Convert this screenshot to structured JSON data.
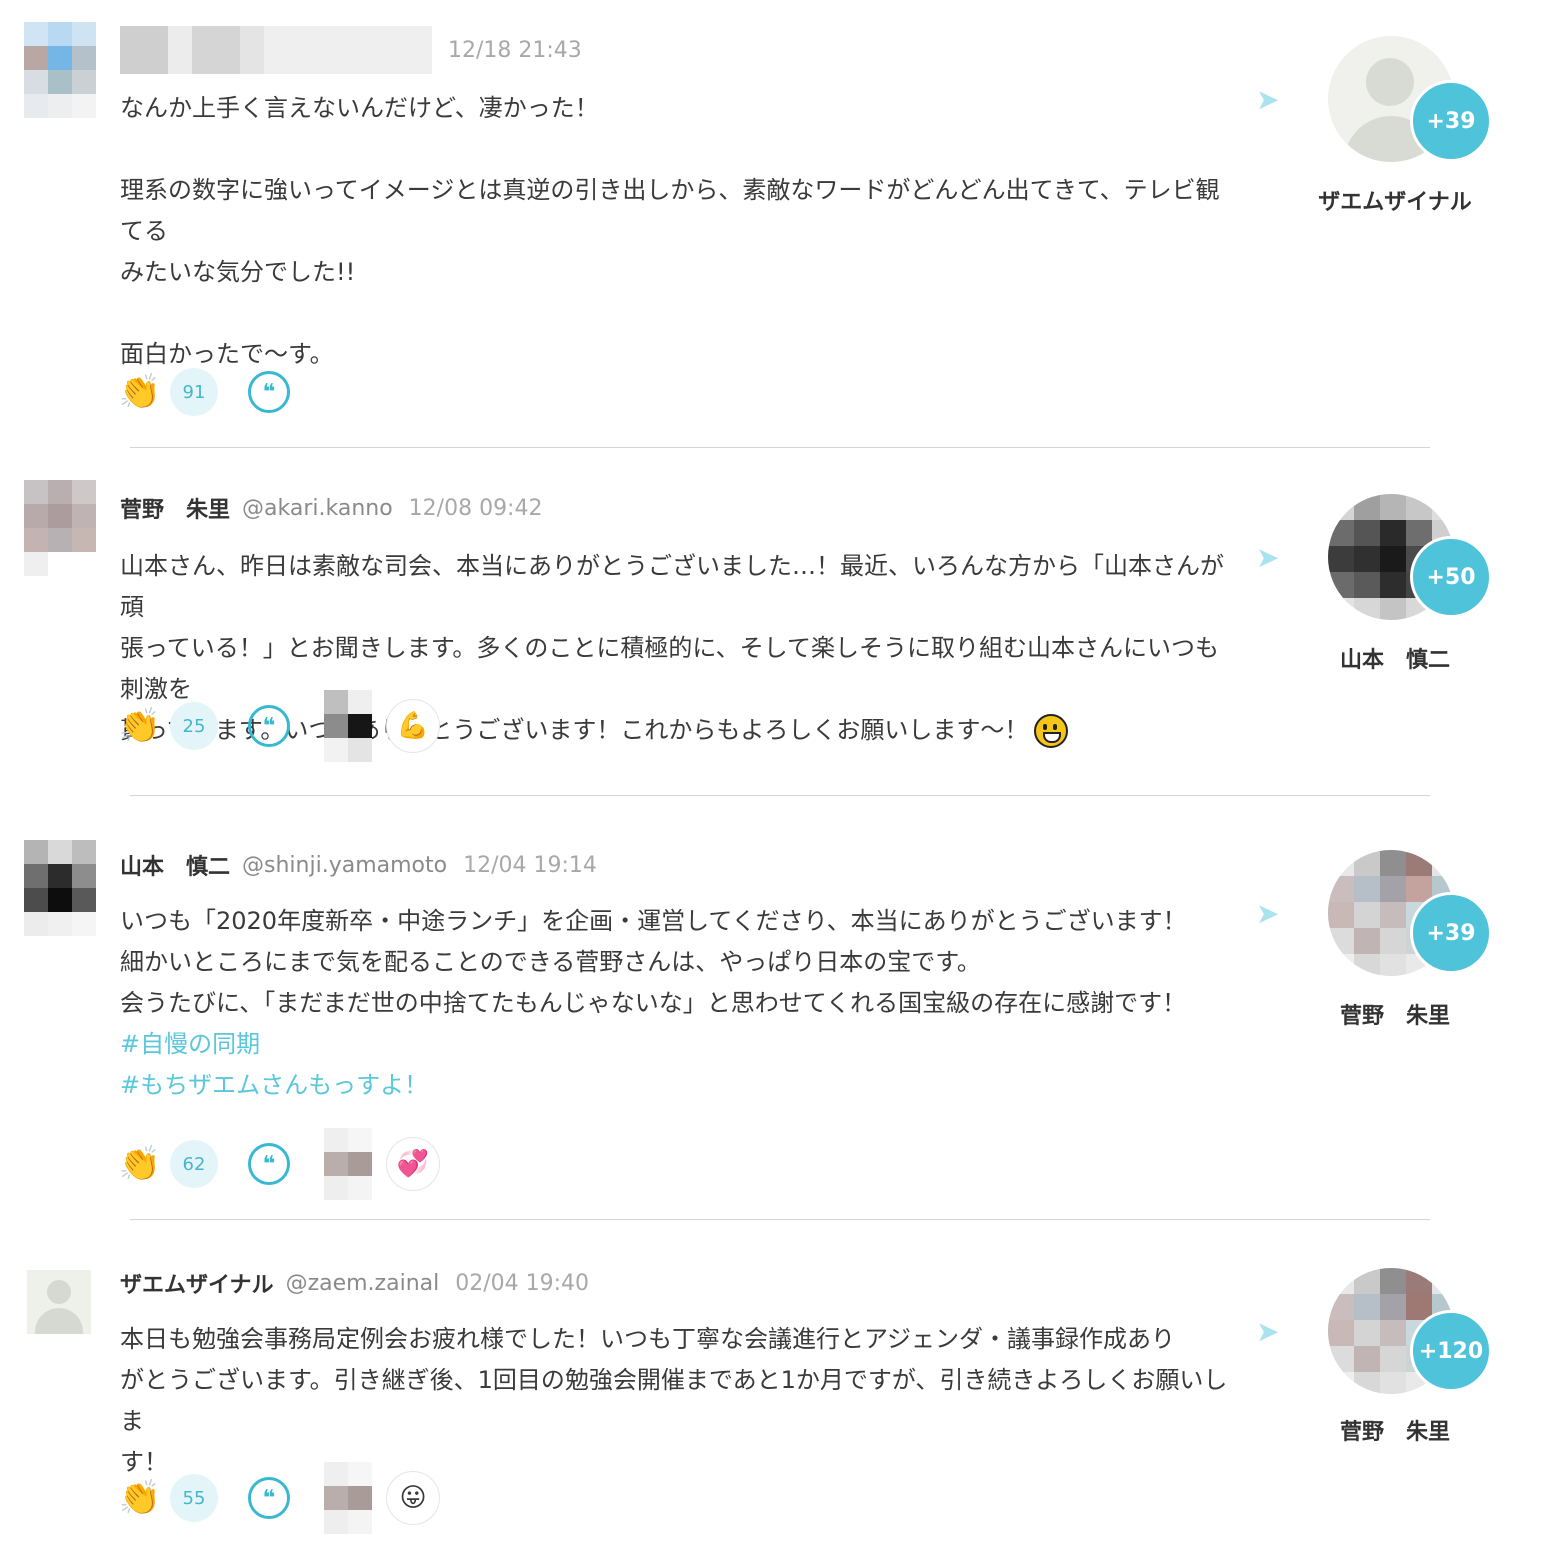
{
  "posts": [
    {
      "name": "",
      "handle": "",
      "time": "12/18 21:43",
      "lines": [
        "なんか上手く言えないんだけど、凄かった！",
        "",
        "理系の数字に強いってイメージとは真逆の引き出しから、素敵なワードがどんどん出てきて、テレビ観てる",
        "みたいな気分でした!!",
        "",
        "面白かったで～す。"
      ],
      "hashtags": [],
      "clap_count": "91",
      "reaction_emoji": "",
      "recipient_name": "ザエムザイナル",
      "recipient_bonus": "+39"
    },
    {
      "name": "菅野　朱里",
      "handle": "@akari.kanno",
      "time": "12/08 09:42",
      "lines": [
        "山本さん、昨日は素敵な司会、本当にありがとうございました…！最近、いろんな方から「山本さんが頑",
        "張っている！」とお聞きします。多くのことに積極的に、そして楽しそうに取り組む山本さんにいつも刺激を",
        "貰っています。いつもありがとうございます！これからもよろしくお願いします～！"
      ],
      "hashtags": [],
      "clap_count": "25",
      "reaction_emoji": "💪",
      "recipient_name": "山本　慎二",
      "recipient_bonus": "+50"
    },
    {
      "name": "山本　慎二",
      "handle": "@shinji.yamamoto",
      "time": "12/04 19:14",
      "lines": [
        "いつも「2020年度新卒・中途ランチ」を企画・運営してくださり、本当にありがとうございます！",
        "細かいところにまで気を配ることのできる菅野さんは、やっぱり日本の宝です。",
        "会うたびに、「まだまだ世の中捨てたもんじゃないな」と思わせてくれる国宝級の存在に感謝です！"
      ],
      "hashtags": [
        "#自慢の同期",
        "#もちザエムさんもっすよ！"
      ],
      "clap_count": "62",
      "reaction_emoji": "💞",
      "recipient_name": "菅野　朱里",
      "recipient_bonus": "+39"
    },
    {
      "name": "ザエムザイナル",
      "handle": "@zaem.zainal",
      "time": "02/04 19:40",
      "lines": [
        "本日も勉強会事務局定例会お疲れ様でした！いつも丁寧な会議進行とアジェンダ・議事録作成あり",
        "がとうございます。引き継ぎ後、1回目の勉強会開催まであと1か月ですが、引き続きよろしくお願いしま",
        "す！"
      ],
      "hashtags": [],
      "clap_count": "55",
      "reaction_emoji": "😛",
      "recipient_name": "菅野　朱里",
      "recipient_bonus": "+120"
    }
  ],
  "icons": {
    "clap": "clap-icon",
    "quote": "quote-icon",
    "send": "send-arrow-icon"
  },
  "colors": {
    "accent": "#4fc3da",
    "hashtag": "#5bc7da",
    "text": "#3a3a3a",
    "muted": "#a8a8a8"
  }
}
